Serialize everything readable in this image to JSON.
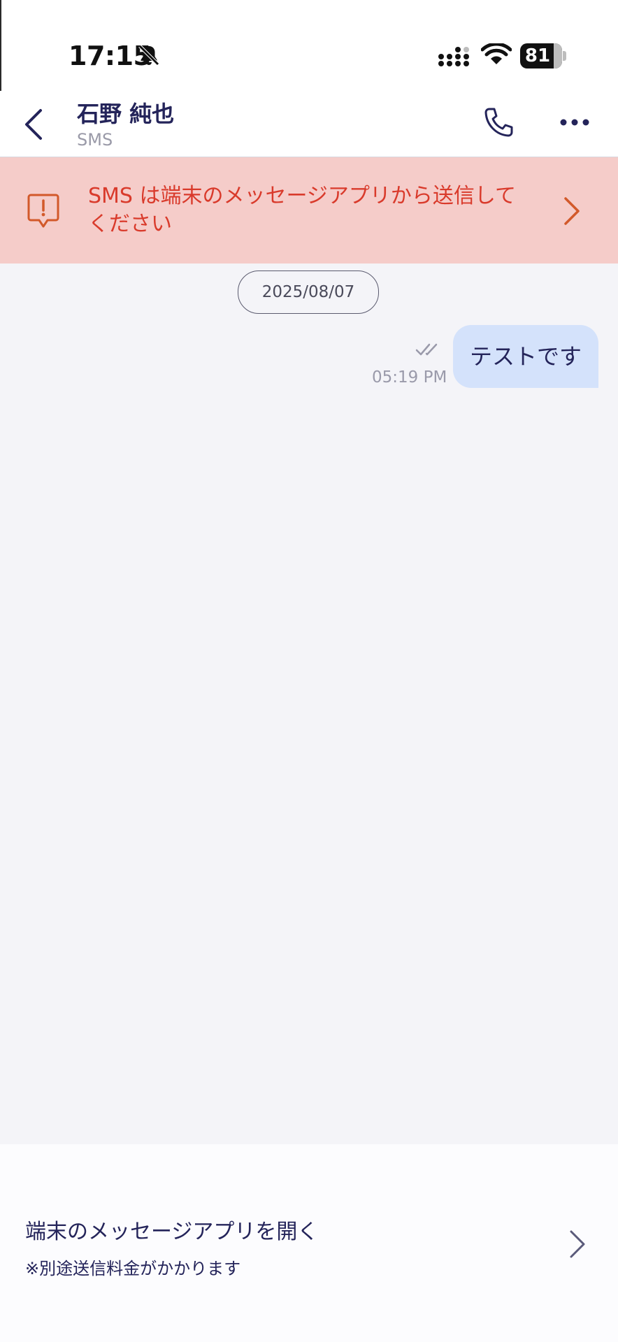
{
  "status_bar": {
    "time": "17:15",
    "battery": "81",
    "icons": [
      "bell-slash-icon",
      "signal-icon",
      "wifi-icon",
      "battery-icon"
    ]
  },
  "header": {
    "contact_name": "石野 純也",
    "channel": "SMS",
    "icons": [
      "back-chevron-icon",
      "phone-icon",
      "more-icon"
    ]
  },
  "banner": {
    "text": "SMS は端末のメッセージアプリから送信してください",
    "icon": "alert-message-icon",
    "accent": "#d93a2b",
    "background": "#f5ccc9"
  },
  "chat": {
    "date": "2025/08/07",
    "messages": [
      {
        "text": "テストです",
        "time": "05:19 PM",
        "status": "read"
      }
    ],
    "bubble_color": "#d4e2fb"
  },
  "bottom": {
    "title": "端末のメッセージアプリを開く",
    "note": "※別途送信料金がかかります"
  }
}
